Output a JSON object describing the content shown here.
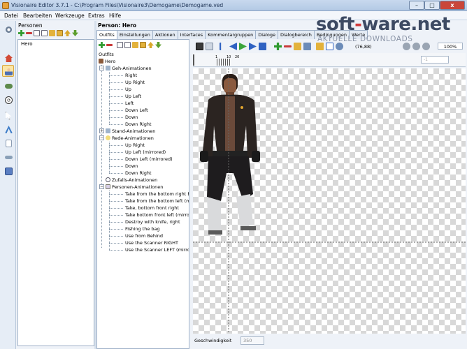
{
  "window": {
    "title": "Visionaire Editor 3.7.1 - C:\\Program Files\\Visionaire3\\Demogame\\Demogame.ved",
    "min": "–",
    "max": "□",
    "close": "x"
  },
  "menu": [
    "Datei",
    "Bearbeiten",
    "Werkzeuge",
    "Extras",
    "Hilfe"
  ],
  "watermark": {
    "brand_a": "soft",
    "brand_dash": "-",
    "brand_b": "ware.net",
    "tagline": "AKTUELLE DOWNLOADS"
  },
  "left_icons": [
    "gear-icon",
    "home-icon",
    "character-icon",
    "gamepad-icon",
    "ball-icon",
    "cursor-icon",
    "text-icon",
    "document-icon",
    "link-icon",
    "floppy-icon"
  ],
  "persons": {
    "title": "Personen",
    "items": [
      "Hero"
    ]
  },
  "person": {
    "title": "Person: Hero"
  },
  "tabs": [
    "Outfits",
    "Einstellungen",
    "Aktionen",
    "Interfaces",
    "Kommentargruppen",
    "Dialoge",
    "Dialogbereich",
    "Bedingungen",
    "Werte"
  ],
  "tree": {
    "root": "Outfits",
    "outfit": "Hero",
    "geh": {
      "label": "Geh-Animationen",
      "items": [
        "Right",
        "Up Right",
        "Up",
        "Up Left",
        "Left",
        "Down Left",
        "Down",
        "Down Right"
      ]
    },
    "stand": {
      "label": "Stand-Animationen"
    },
    "rede": {
      "label": "Rede-Animationen",
      "items": [
        "Up Right",
        "Up Left (mirrored)",
        "Down Left (mirrored)",
        "Down",
        "Down Right"
      ]
    },
    "zufall": {
      "label": "Zufalls-Animationen"
    },
    "personen": {
      "label": "Personen-Animationen",
      "items": [
        "Take from the bottom right b",
        "Take from the bottom left (m",
        "Take, bottom front right",
        "Take bottom front left (mirro",
        "Destroy with knife, right",
        "Fishing the bag",
        "Use from Behind",
        "Use the Scanner RIGHT",
        "Use the Scanner LEFT (mirro"
      ]
    }
  },
  "canvas": {
    "coords": "(76,88)",
    "zoom": "100%",
    "frame": "-1",
    "ruler": [
      "1",
      "10",
      "20"
    ]
  },
  "speed": {
    "label": "Geschwindigkeit",
    "value": "350"
  }
}
